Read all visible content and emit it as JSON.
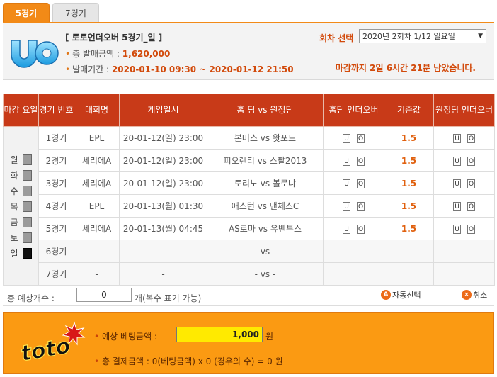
{
  "tabs": [
    {
      "label": "5경기",
      "active": true
    },
    {
      "label": "7경기",
      "active": false
    }
  ],
  "header": {
    "game_title": "[ 토토언더오버 5경기_일 ]",
    "total_sales_label": "총 발매금액 :",
    "total_sales_value": "1,620,000",
    "period_label": "발매기간 :",
    "period_value": "2020-01-10 09:30 ~ 2020-01-12 21:50",
    "round_label": "회차 선택",
    "round_selected": "2020년 2회차 1/12 일요일",
    "deadline": "마감까지 2일 6시간 21분 남았습니다."
  },
  "table": {
    "headers": {
      "close_day": "마감 요일",
      "game_no": "경기 번호",
      "league": "대회명",
      "datetime": "게임일시",
      "match": "홈  팀 vs 원정팀",
      "home_ou": "홈팀 언더오버",
      "base": "기준값",
      "away_ou": "원정팀 언더오버"
    },
    "days": [
      {
        "label": "월",
        "selected": false
      },
      {
        "label": "화",
        "selected": false
      },
      {
        "label": "수",
        "selected": false
      },
      {
        "label": "목",
        "selected": false
      },
      {
        "label": "금",
        "selected": false
      },
      {
        "label": "토",
        "selected": false
      },
      {
        "label": "일",
        "selected": true
      }
    ],
    "under_label": "U",
    "over_label": "O",
    "rows": [
      {
        "game": "1경기",
        "league": "EPL",
        "datetime": "20-01-12(일) 23:00",
        "match": "본머스 vs 왓포드",
        "base": "1.5"
      },
      {
        "game": "2경기",
        "league": "세리에A",
        "datetime": "20-01-12(일) 23:00",
        "match": "피오렌티 vs 스팔2013",
        "base": "1.5"
      },
      {
        "game": "3경기",
        "league": "세리에A",
        "datetime": "20-01-12(일) 23:00",
        "match": "토리노 vs 볼로냐",
        "base": "1.5"
      },
      {
        "game": "4경기",
        "league": "EPL",
        "datetime": "20-01-13(월) 01:30",
        "match": "애스턴 vs 맨체스C",
        "base": "1.5"
      },
      {
        "game": "5경기",
        "league": "세리에A",
        "datetime": "20-01-13(월) 04:45",
        "match": "AS로마 vs 유벤투스",
        "base": "1.5"
      },
      {
        "game": "6경기",
        "league": "-",
        "datetime": "-",
        "match": "- vs -",
        "base": ""
      },
      {
        "game": "7경기",
        "league": "-",
        "datetime": "-",
        "match": "- vs -",
        "base": ""
      }
    ]
  },
  "count": {
    "label": "총 예상개수 :",
    "value": "0",
    "note": "개(복수 표기 가능)",
    "auto_icon": "A",
    "auto_label": "자동선택",
    "cancel_icon": "×",
    "cancel_label": "취소"
  },
  "footer": {
    "logo_text": "toto",
    "bet_label": "예상 베팅금액 :",
    "bet_value": "1,000",
    "bet_unit": "원",
    "total_label": "총 결제금액 : 0(베팅금액) x 0 (경우의 수) = 0 원"
  },
  "colors": {
    "accent": "#f28a17",
    "header_red": "#c83a18",
    "highlight": "#d24a0b",
    "bet_input": "#ffea00"
  }
}
